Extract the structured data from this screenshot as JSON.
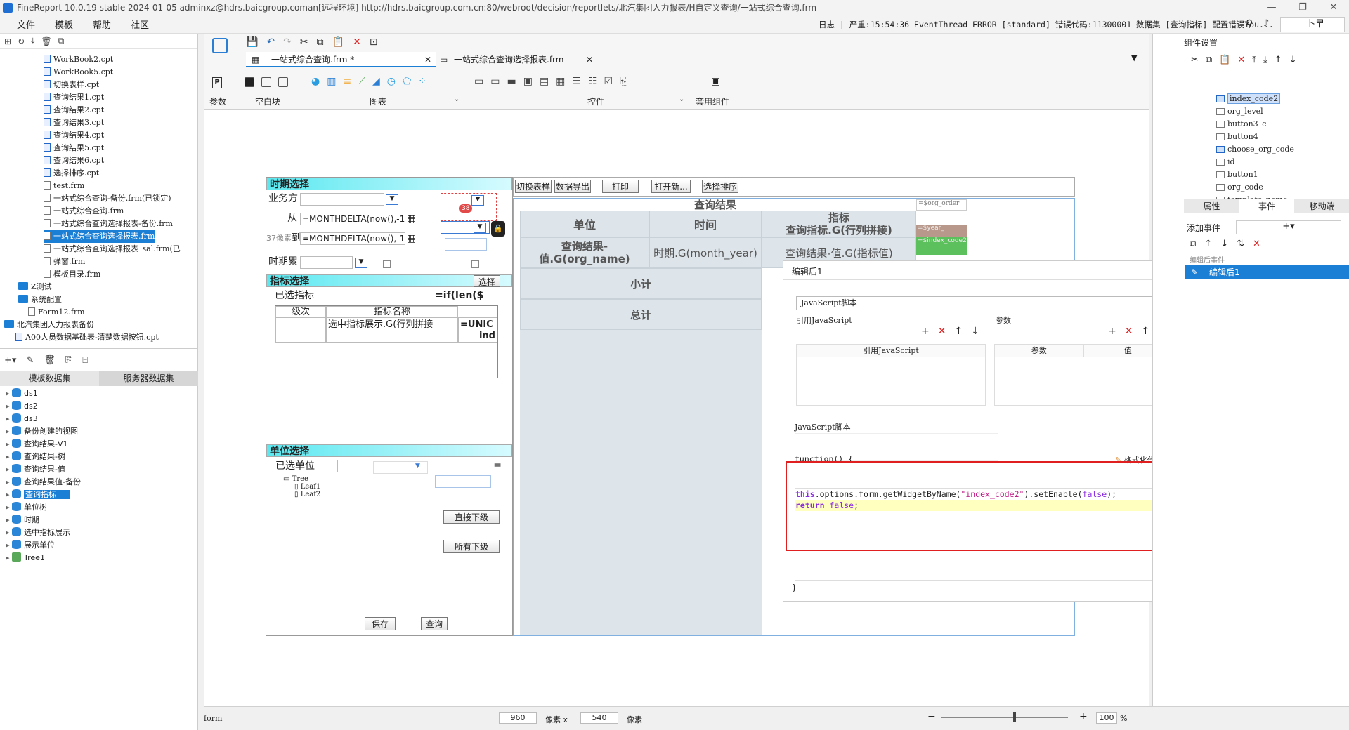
{
  "window": {
    "title": "FineReport 10.0.19 stable 2024-01-05 adminxz@hdrs.baicgroup.coman[远程环境]   http://hdrs.baicgroup.com.cn:80/webroot/decision/reportlets/北汽集团人力报表/H自定义查询/一站式综合查询.frm"
  },
  "menu": {
    "items": [
      "文件",
      "模板",
      "帮助",
      "社区"
    ],
    "log_label": "日志",
    "log_text": "严重:15:54:36 EventThread ERROR [standard] 错误代码:11300001 数据集 [查询指标] 配置错误You...",
    "user": "卜早"
  },
  "file_tree": [
    {
      "name": "WorkBook2.cpt",
      "type": "cpt"
    },
    {
      "name": "WorkBook5.cpt",
      "type": "cpt"
    },
    {
      "name": "切换表样.cpt",
      "type": "cpt"
    },
    {
      "name": "查询结果1.cpt",
      "type": "cpt"
    },
    {
      "name": "查询结果2.cpt",
      "type": "cpt"
    },
    {
      "name": "查询结果3.cpt",
      "type": "cpt"
    },
    {
      "name": "查询结果4.cpt",
      "type": "cpt"
    },
    {
      "name": "查询结果5.cpt",
      "type": "cpt"
    },
    {
      "name": "查询结果6.cpt",
      "type": "cpt"
    },
    {
      "name": "选择排序.cpt",
      "type": "cpt"
    },
    {
      "name": "test.frm",
      "type": "frm"
    },
    {
      "name": "一站式综合查询-备份.frm(已锁定)",
      "type": "frm"
    },
    {
      "name": "一站式综合查询.frm",
      "type": "frm"
    },
    {
      "name": "一站式综合查询选择报表-备份.frm",
      "type": "frm"
    },
    {
      "name": "一站式综合查询选择报表.frm",
      "type": "frm",
      "selected": true
    },
    {
      "name": "一站式综合查询选择报表_sal.frm(已",
      "type": "frm"
    },
    {
      "name": "弹窗.frm",
      "type": "frm"
    },
    {
      "name": "模板目录.frm",
      "type": "frm"
    },
    {
      "name": "Z测试",
      "type": "folder"
    },
    {
      "name": "系统配置",
      "type": "folder"
    },
    {
      "name": "Form12.frm",
      "type": "frm"
    },
    {
      "name": "北汽集团人力报表备份",
      "type": "folder"
    },
    {
      "name": "A00人员数据基础表-清楚数据按钮.cpt",
      "type": "cpt"
    }
  ],
  "dataset_tabs": [
    "模板数据集",
    "服务器数据集"
  ],
  "datasets": [
    "ds1",
    "ds2",
    "ds3",
    "备份创建的视图",
    "查询结果-V1",
    "查询结果-树",
    "查询结果-值",
    "查询结果值-备份",
    "查询指标",
    "单位树",
    "时期",
    "选中指标展示",
    "展示单位",
    "Tree1"
  ],
  "datasets_selected": "查询指标",
  "file_tabs": [
    "一站式综合查询.frm *",
    "一站式综合查询选择报表.frm"
  ],
  "ribbon": {
    "groups": [
      "参数",
      "空白块",
      "图表",
      "控件",
      "套用组件"
    ]
  },
  "form": {
    "period_header": "时期选择",
    "business_label": "业务方",
    "from_label": "从",
    "to_label": "到",
    "from_formula": "=MONTHDELTA(now(),-1)",
    "to_formula": "=MONTHDELTA(now(),-1)",
    "period_acc_label": "时期累",
    "badge": "38",
    "hint": "37像素",
    "indicator_header": "指标选择",
    "select_btn": "选择",
    "selected_ind": "已选指标",
    "if_formula": "=if(len($",
    "level_col": "级次",
    "name_col": "指标名称",
    "ind_cell": "选中指标展示.G(行列拼接",
    "unic": "=UNIC",
    "ind": "ind",
    "unit_header": "单位选择",
    "selected_unit": "已选单位",
    "eq": "=",
    "tree_root": "Tree",
    "leaf1": "Leaf1",
    "leaf2": "Leaf2",
    "direct_btn": "直接下级",
    "all_btn": "所有下级",
    "save_btn": "保存",
    "query_btn": "查询",
    "toolbar_btns": [
      "切换表样",
      "数据导出",
      "打印",
      "打开新...",
      "选择排序"
    ],
    "result_title": "查询结果",
    "unit_col": "单位",
    "time_col": "时间",
    "ind_col": "指标",
    "org_order": "=$org_order",
    "ind_query": "查询指标.G(行列拼接)",
    "year": "=$year_",
    "unit_val": "查询结果-值.G(org_name)",
    "time_val": "时期.G(month_year)",
    "ind_val": "查询结果-值.G(指标值)",
    "index_code": "=$index_code2",
    "subtotal": "小计",
    "total": "总计"
  },
  "event_editor": {
    "title": "编辑后1",
    "script_type": "JavaScript脚本",
    "ref_js": "引用JavaScript",
    "params": "参数",
    "col_ref": "引用JavaScript",
    "col_param": "参数",
    "col_value": "值",
    "script_label": "JavaScript脚本",
    "format_code": "格式化代码",
    "func_open": "function() {",
    "code_line1_kw": "this",
    "code_line1_a": ".options.form.getWidgetByName(",
    "code_line1_str": "\"index_code2\"",
    "code_line1_b": ").setEnable(",
    "code_line1_c": "false",
    "code_line1_d": ");",
    "code_line2_kw": "return",
    "code_line2_val": " false",
    "code_line2_end": ";",
    "func_close": "}"
  },
  "right_panel": {
    "title": "组件设置",
    "widgets": [
      "index_code2",
      "org_level",
      "button3_c",
      "button4",
      "choose_org_code",
      "id",
      "button1",
      "org_code",
      "template_name"
    ],
    "tabs": [
      "属性",
      "事件",
      "移动端"
    ],
    "add_event": "添加事件",
    "after_edit_event": "编辑后事件",
    "event_item": "编辑后1"
  },
  "status": {
    "name": "form",
    "width": "960",
    "unit1": "像素 x",
    "height": "540",
    "unit2": "像素",
    "zoom": "100",
    "pct": "%"
  },
  "colors": {
    "accent": "#1b7fd6",
    "highlight": "#e02020",
    "header_cyan": "#5ce8f0"
  }
}
